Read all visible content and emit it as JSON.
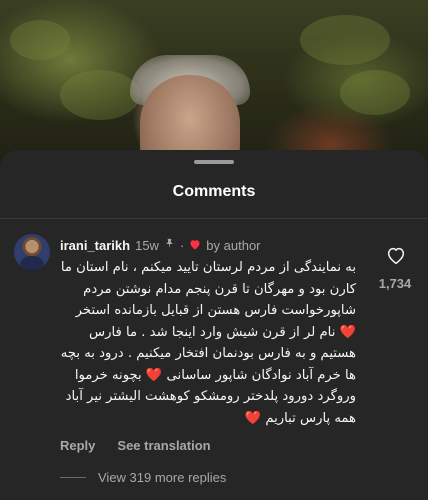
{
  "sheet": {
    "title": "Comments"
  },
  "comment": {
    "username": "irani_tarikh",
    "time_ago": "15w",
    "pin_icon": "pin-icon",
    "separator": "·",
    "heart_icon": "red-heart-icon",
    "by_author": "by author",
    "text": "به نمایندگی از مردم لرستان تایید میکنم ، نام استان ما کارن بود و مهرگان تا قرن پنجم مدام نوشتن مردم شاپورخواست فارس هستن از قبایل بازمانده استخر ❤️ نام لر از قرن شیش وارد اینجا شد . ما فارس هستیم و به فارس بودنمان افتخار میکنیم . درود به بچه ها خرم آباد نوادگان شاپور ساسانی ❤️ بچونه خرموا وروگرد دورود پلدختر رومشکو کوهشت الیشتر نیر آباد همه پارس تباریم ❤️",
    "like_icon": "heart-outline-icon",
    "like_count": "1,734",
    "reply_label": "Reply",
    "translation_label": "See translation"
  },
  "replies": {
    "more_label": "View 319 more replies"
  },
  "colors": {
    "sheet_bg": "#262626",
    "secondary_text": "#a8a8a8",
    "heart_accent": "#ff3040"
  }
}
